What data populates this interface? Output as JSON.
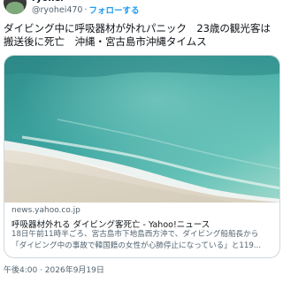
{
  "user": {
    "display_name": "ryoher",
    "handle": "@ryohei470",
    "separator": "·",
    "follow_label": "フォローする"
  },
  "tweet": {
    "text": "ダイビング中に呼吸器材が外れパニック　23歳の観光客は搬送後に死亡　沖縄・宮古島市沖縄タイムス"
  },
  "card": {
    "image_icon": "beach-photo",
    "domain": "news.yahoo.co.jp",
    "title": "呼吸器材外れる ダイビング客死亡 - Yahoo!ニュース",
    "description_line1": "18日午前11時半ごろ、宮古島市下地島西方沖で、ダイビング船船長から",
    "description_line2": "「ダイビング中の事故で韓国籍の女性が心肺停止になっている」と119..."
  },
  "meta": {
    "timestamp": "午後4:00 · 2026年9月19日"
  }
}
